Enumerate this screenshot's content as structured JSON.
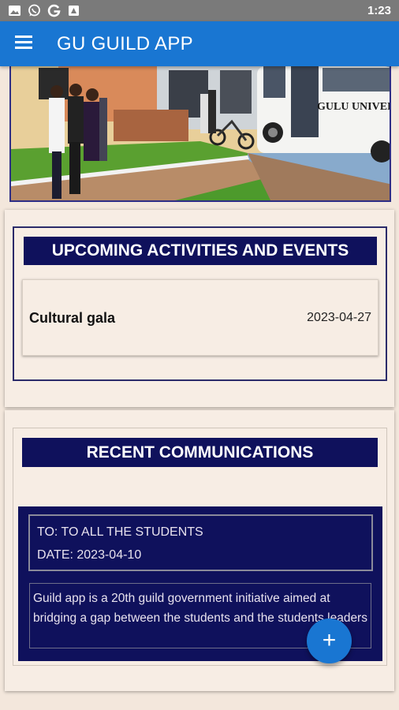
{
  "status_bar": {
    "time": "1:23",
    "icons": [
      "gallery-icon",
      "whatsapp-icon",
      "google-icon",
      "document-icon"
    ]
  },
  "app_bar": {
    "title": "GU GUILD APP",
    "menu_icon": "hamburger-menu-icon",
    "color": "#1976d2"
  },
  "hero": {
    "bus_text": "GULU UNIVERS"
  },
  "events_section": {
    "title": "UPCOMING ACTIVITIES AND EVENTS",
    "events": [
      {
        "name": "Cultural gala",
        "date": "2023-04-27"
      }
    ]
  },
  "communications_section": {
    "title": "RECENT COMMUNICATIONS",
    "items": [
      {
        "to": "TO: TO ALL THE STUDENTS",
        "date": "DATE: 2023-04-10",
        "message": "Guild app is a 20th guild government initiative aimed at bridging a gap between the students and the students leaders"
      }
    ]
  },
  "fab": {
    "label": "+",
    "icon": "plus-icon"
  },
  "colors": {
    "navy": "#0f115c",
    "background": "#f3e7dc",
    "accent": "#1976d2"
  }
}
